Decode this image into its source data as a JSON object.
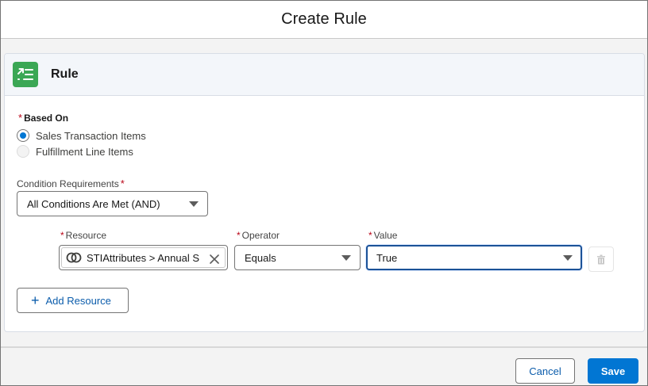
{
  "modal": {
    "title": "Create Rule"
  },
  "card": {
    "title": "Rule",
    "icon": "rule-list-icon",
    "icon_color": "#3ba755"
  },
  "based_on": {
    "label": "Based On",
    "required_marker": "*",
    "options": [
      {
        "label": "Sales Transaction Items",
        "selected": true,
        "disabled": false
      },
      {
        "label": "Fulfillment Line Items",
        "selected": false,
        "disabled": true
      }
    ]
  },
  "condition_requirements": {
    "label": "Condition Requirements",
    "required_marker": "*",
    "value": "All Conditions Are Met (AND)"
  },
  "condition_row": {
    "resource": {
      "label": "Resource",
      "required_marker": "*",
      "value": "STIAttributes > Annual S",
      "icon": "attribute-link-icon"
    },
    "operator": {
      "label": "Operator",
      "required_marker": "*",
      "value": "Equals"
    },
    "value": {
      "label": "Value",
      "required_marker": "*",
      "value": "True"
    },
    "delete_icon": "trash-icon"
  },
  "add_resource": {
    "label": "Add Resource",
    "icon": "plus-icon"
  },
  "footer": {
    "cancel_label": "Cancel",
    "save_label": "Save"
  },
  "colors": {
    "brand_blue": "#0176d3",
    "link_blue": "#0b5cab",
    "required_red": "#ba0517",
    "focus_border": "#1b5297"
  }
}
